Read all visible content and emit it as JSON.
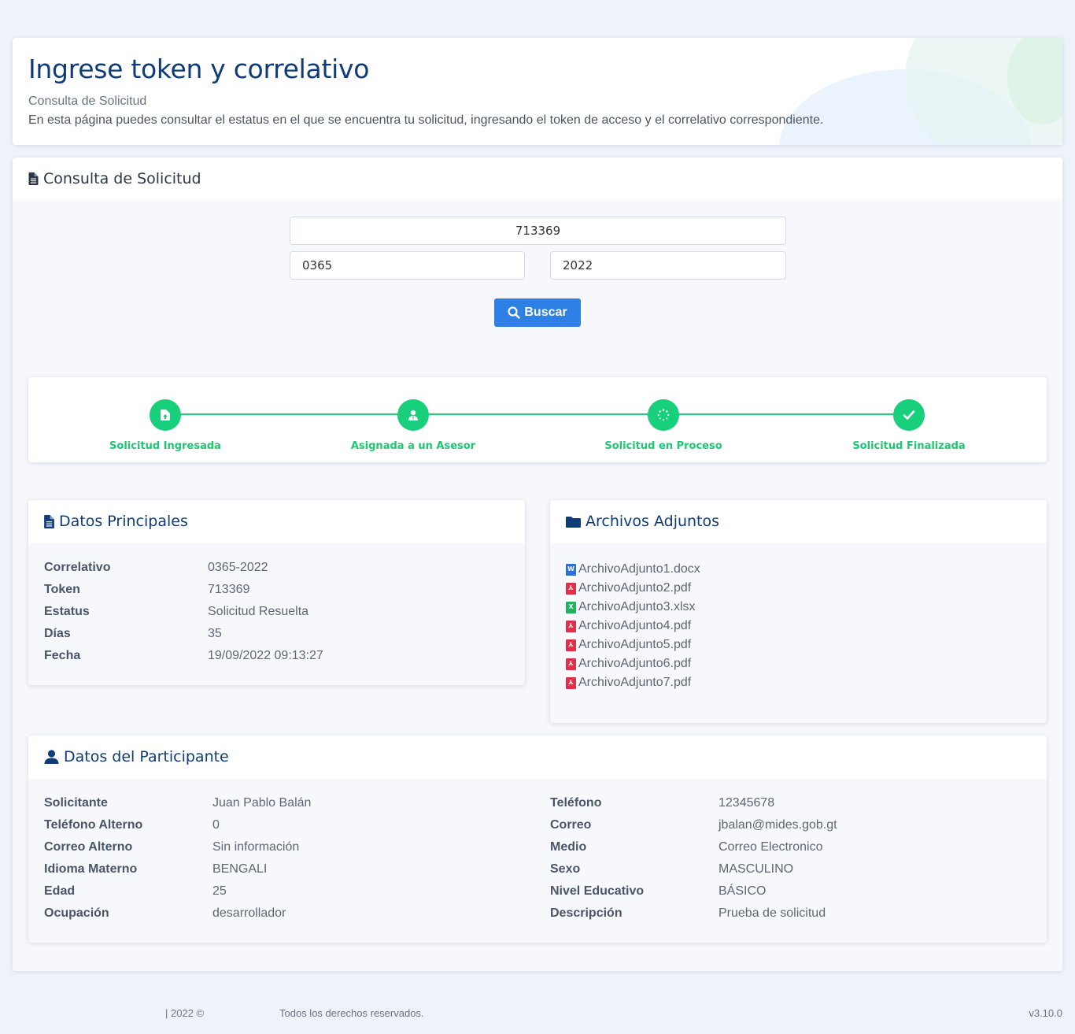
{
  "hero": {
    "title": "Ingrese token y correlativo",
    "subtitle": "Consulta de Solicitud",
    "description": "En esta página puedes consultar el estatus en el que se encuentra tu solicitud, ingresando el token de acceso y el correlativo correspondiente."
  },
  "consulta": {
    "title": "Consulta de Solicitud",
    "token_value": "713369",
    "correlativo_value": "0365",
    "year_value": "2022",
    "search_label": "Buscar"
  },
  "stepper": {
    "accent_color": "#18cf7b",
    "steps": [
      {
        "label": "Solicitud Ingresada",
        "icon": "file-upload-icon"
      },
      {
        "label": "Asignada a un Asesor",
        "icon": "user-tie-icon"
      },
      {
        "label": "Solicitud en Proceso",
        "icon": "spinner-icon"
      },
      {
        "label": "Solicitud Finalizada",
        "icon": "check-icon"
      }
    ]
  },
  "principal": {
    "title": "Datos Principales",
    "rows": [
      {
        "label": "Correlativo",
        "value": "0365-2022"
      },
      {
        "label": "Token",
        "value": "713369"
      },
      {
        "label": "Estatus",
        "value": "Solicitud Resuelta"
      },
      {
        "label": "Días",
        "value": "35"
      },
      {
        "label": "Fecha",
        "value": "19/09/2022 09:13:27"
      }
    ]
  },
  "adjuntos": {
    "title": "Archivos Adjuntos",
    "files": [
      {
        "name": "ArchivoAdjunto1.docx",
        "icon": "word-file-icon"
      },
      {
        "name": "ArchivoAdjunto2.pdf",
        "icon": "pdf-file-icon"
      },
      {
        "name": "ArchivoAdjunto3.xlsx",
        "icon": "excel-file-icon"
      },
      {
        "name": "ArchivoAdjunto4.pdf",
        "icon": "pdf-file-icon"
      },
      {
        "name": "ArchivoAdjunto5.pdf",
        "icon": "pdf-file-icon"
      },
      {
        "name": "ArchivoAdjunto6.pdf",
        "icon": "pdf-file-icon"
      },
      {
        "name": "ArchivoAdjunto7.pdf",
        "icon": "pdf-file-icon"
      }
    ]
  },
  "participante": {
    "title": "Datos del Participante",
    "left": [
      {
        "label": "Solicitante",
        "value": "Juan Pablo Balán"
      },
      {
        "label": "Teléfono Alterno",
        "value": "0"
      },
      {
        "label": "Correo Alterno",
        "value": "Sin información"
      },
      {
        "label": "Idioma Materno",
        "value": "BENGALI"
      },
      {
        "label": "Edad",
        "value": "25"
      },
      {
        "label": "Ocupación",
        "value": "desarrollador"
      }
    ],
    "right": [
      {
        "label": "Teléfono",
        "value": "12345678"
      },
      {
        "label": "Correo",
        "value": "jbalan@mides.gob.gt"
      },
      {
        "label": "Medio",
        "value": "Correo Electronico"
      },
      {
        "label": "Sexo",
        "value": "MASCULINO"
      },
      {
        "label": "Nivel Educativo",
        "value": "BÁSICO"
      },
      {
        "label": "Descripción",
        "value": "Prueba de solicitud"
      }
    ]
  },
  "footer": {
    "copyright": "| 2022 ©",
    "rights": "Todos los derechos reservados.",
    "version": "v3.10.0"
  }
}
